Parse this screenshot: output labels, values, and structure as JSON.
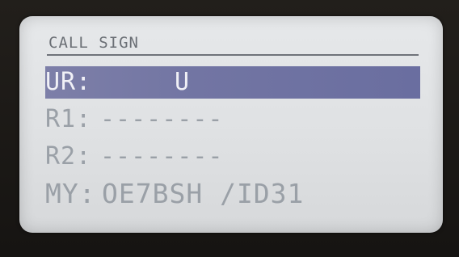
{
  "screen": {
    "title": "CALL SIGN",
    "rows": [
      {
        "label": "UR:",
        "value": "U"
      },
      {
        "label": "R1:",
        "value": "--------"
      },
      {
        "label": "R2:",
        "value": "--------"
      },
      {
        "label": "MY:",
        "value": "OE7BSH /ID31"
      }
    ]
  }
}
